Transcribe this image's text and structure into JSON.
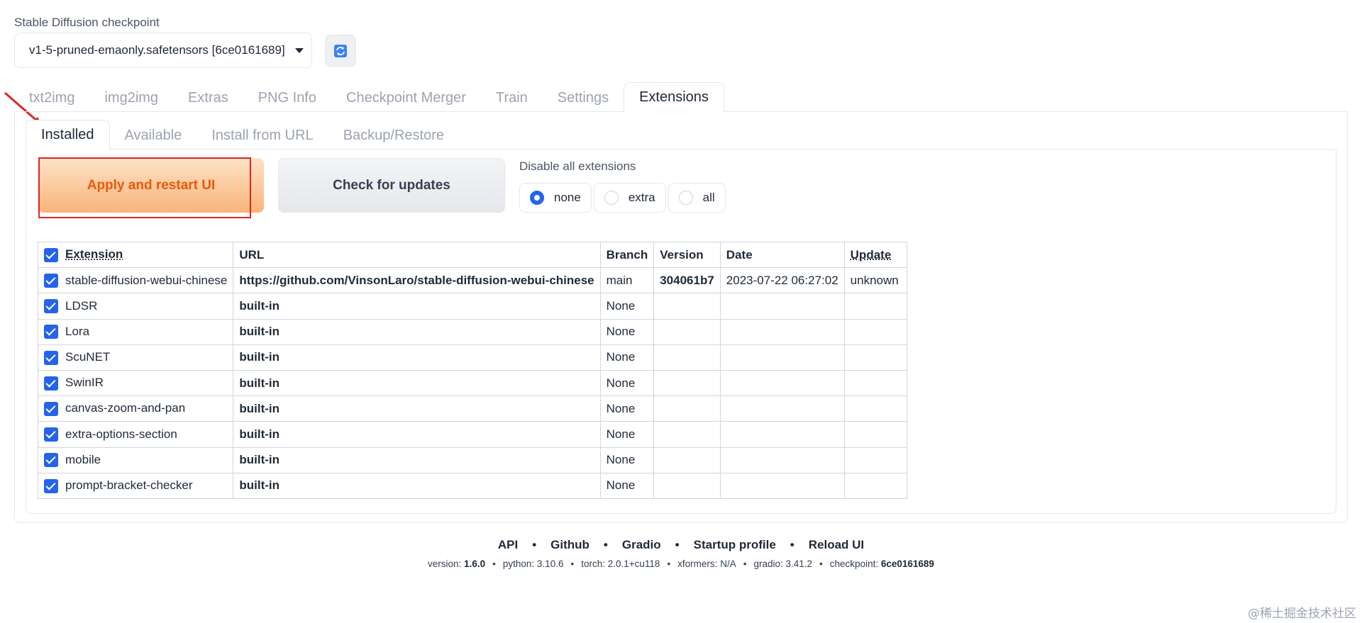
{
  "checkpoint": {
    "label": "Stable Diffusion checkpoint",
    "value": "v1-5-pruned-emaonly.safetensors [6ce0161689]"
  },
  "main_tabs": [
    {
      "label": "txt2img",
      "active": false
    },
    {
      "label": "img2img",
      "active": false
    },
    {
      "label": "Extras",
      "active": false
    },
    {
      "label": "PNG Info",
      "active": false
    },
    {
      "label": "Checkpoint Merger",
      "active": false
    },
    {
      "label": "Train",
      "active": false
    },
    {
      "label": "Settings",
      "active": false
    },
    {
      "label": "Extensions",
      "active": true
    }
  ],
  "sub_tabs": [
    {
      "label": "Installed",
      "active": true
    },
    {
      "label": "Available",
      "active": false
    },
    {
      "label": "Install from URL",
      "active": false
    },
    {
      "label": "Backup/Restore",
      "active": false
    }
  ],
  "actions": {
    "apply_label": "Apply and restart UI",
    "check_label": "Check for updates"
  },
  "disable": {
    "label": "Disable all extensions",
    "options": [
      "none",
      "extra",
      "all"
    ],
    "selected": "none"
  },
  "table": {
    "headers": [
      "Extension",
      "URL",
      "Branch",
      "Version",
      "Date",
      "Update"
    ],
    "rows": [
      {
        "name": "stable-diffusion-webui-chinese",
        "url": "https://github.com/VinsonLaro/stable-diffusion-webui-chinese",
        "branch": "main",
        "version": "304061b7",
        "date": "2023-07-22 06:27:02",
        "update": "unknown"
      },
      {
        "name": "LDSR",
        "url": "built-in",
        "branch": "None",
        "version": "",
        "date": "",
        "update": ""
      },
      {
        "name": "Lora",
        "url": "built-in",
        "branch": "None",
        "version": "",
        "date": "",
        "update": ""
      },
      {
        "name": "ScuNET",
        "url": "built-in",
        "branch": "None",
        "version": "",
        "date": "",
        "update": ""
      },
      {
        "name": "SwinIR",
        "url": "built-in",
        "branch": "None",
        "version": "",
        "date": "",
        "update": ""
      },
      {
        "name": "canvas-zoom-and-pan",
        "url": "built-in",
        "branch": "None",
        "version": "",
        "date": "",
        "update": ""
      },
      {
        "name": "extra-options-section",
        "url": "built-in",
        "branch": "None",
        "version": "",
        "date": "",
        "update": ""
      },
      {
        "name": "mobile",
        "url": "built-in",
        "branch": "None",
        "version": "",
        "date": "",
        "update": ""
      },
      {
        "name": "prompt-bracket-checker",
        "url": "built-in",
        "branch": "None",
        "version": "",
        "date": "",
        "update": ""
      }
    ]
  },
  "footer": {
    "links": [
      "API",
      "Github",
      "Gradio",
      "Startup profile",
      "Reload UI"
    ],
    "separator": "•",
    "info": [
      {
        "key": "version:",
        "value": "1.6.0",
        "bold": true
      },
      {
        "key": "python:",
        "value": "3.10.6",
        "bold": false
      },
      {
        "key": "torch:",
        "value": "2.0.1+cu118",
        "bold": false
      },
      {
        "key": "xformers:",
        "value": "N/A",
        "bold": false
      },
      {
        "key": "gradio:",
        "value": "3.41.2",
        "bold": false
      },
      {
        "key": "checkpoint:",
        "value": "6ce0161689",
        "bold": true
      }
    ]
  },
  "watermark": "@稀土掘金技术社区",
  "colors": {
    "accent": "#2563eb",
    "primary_text": "#ea580c",
    "highlight": "#dc2626"
  }
}
